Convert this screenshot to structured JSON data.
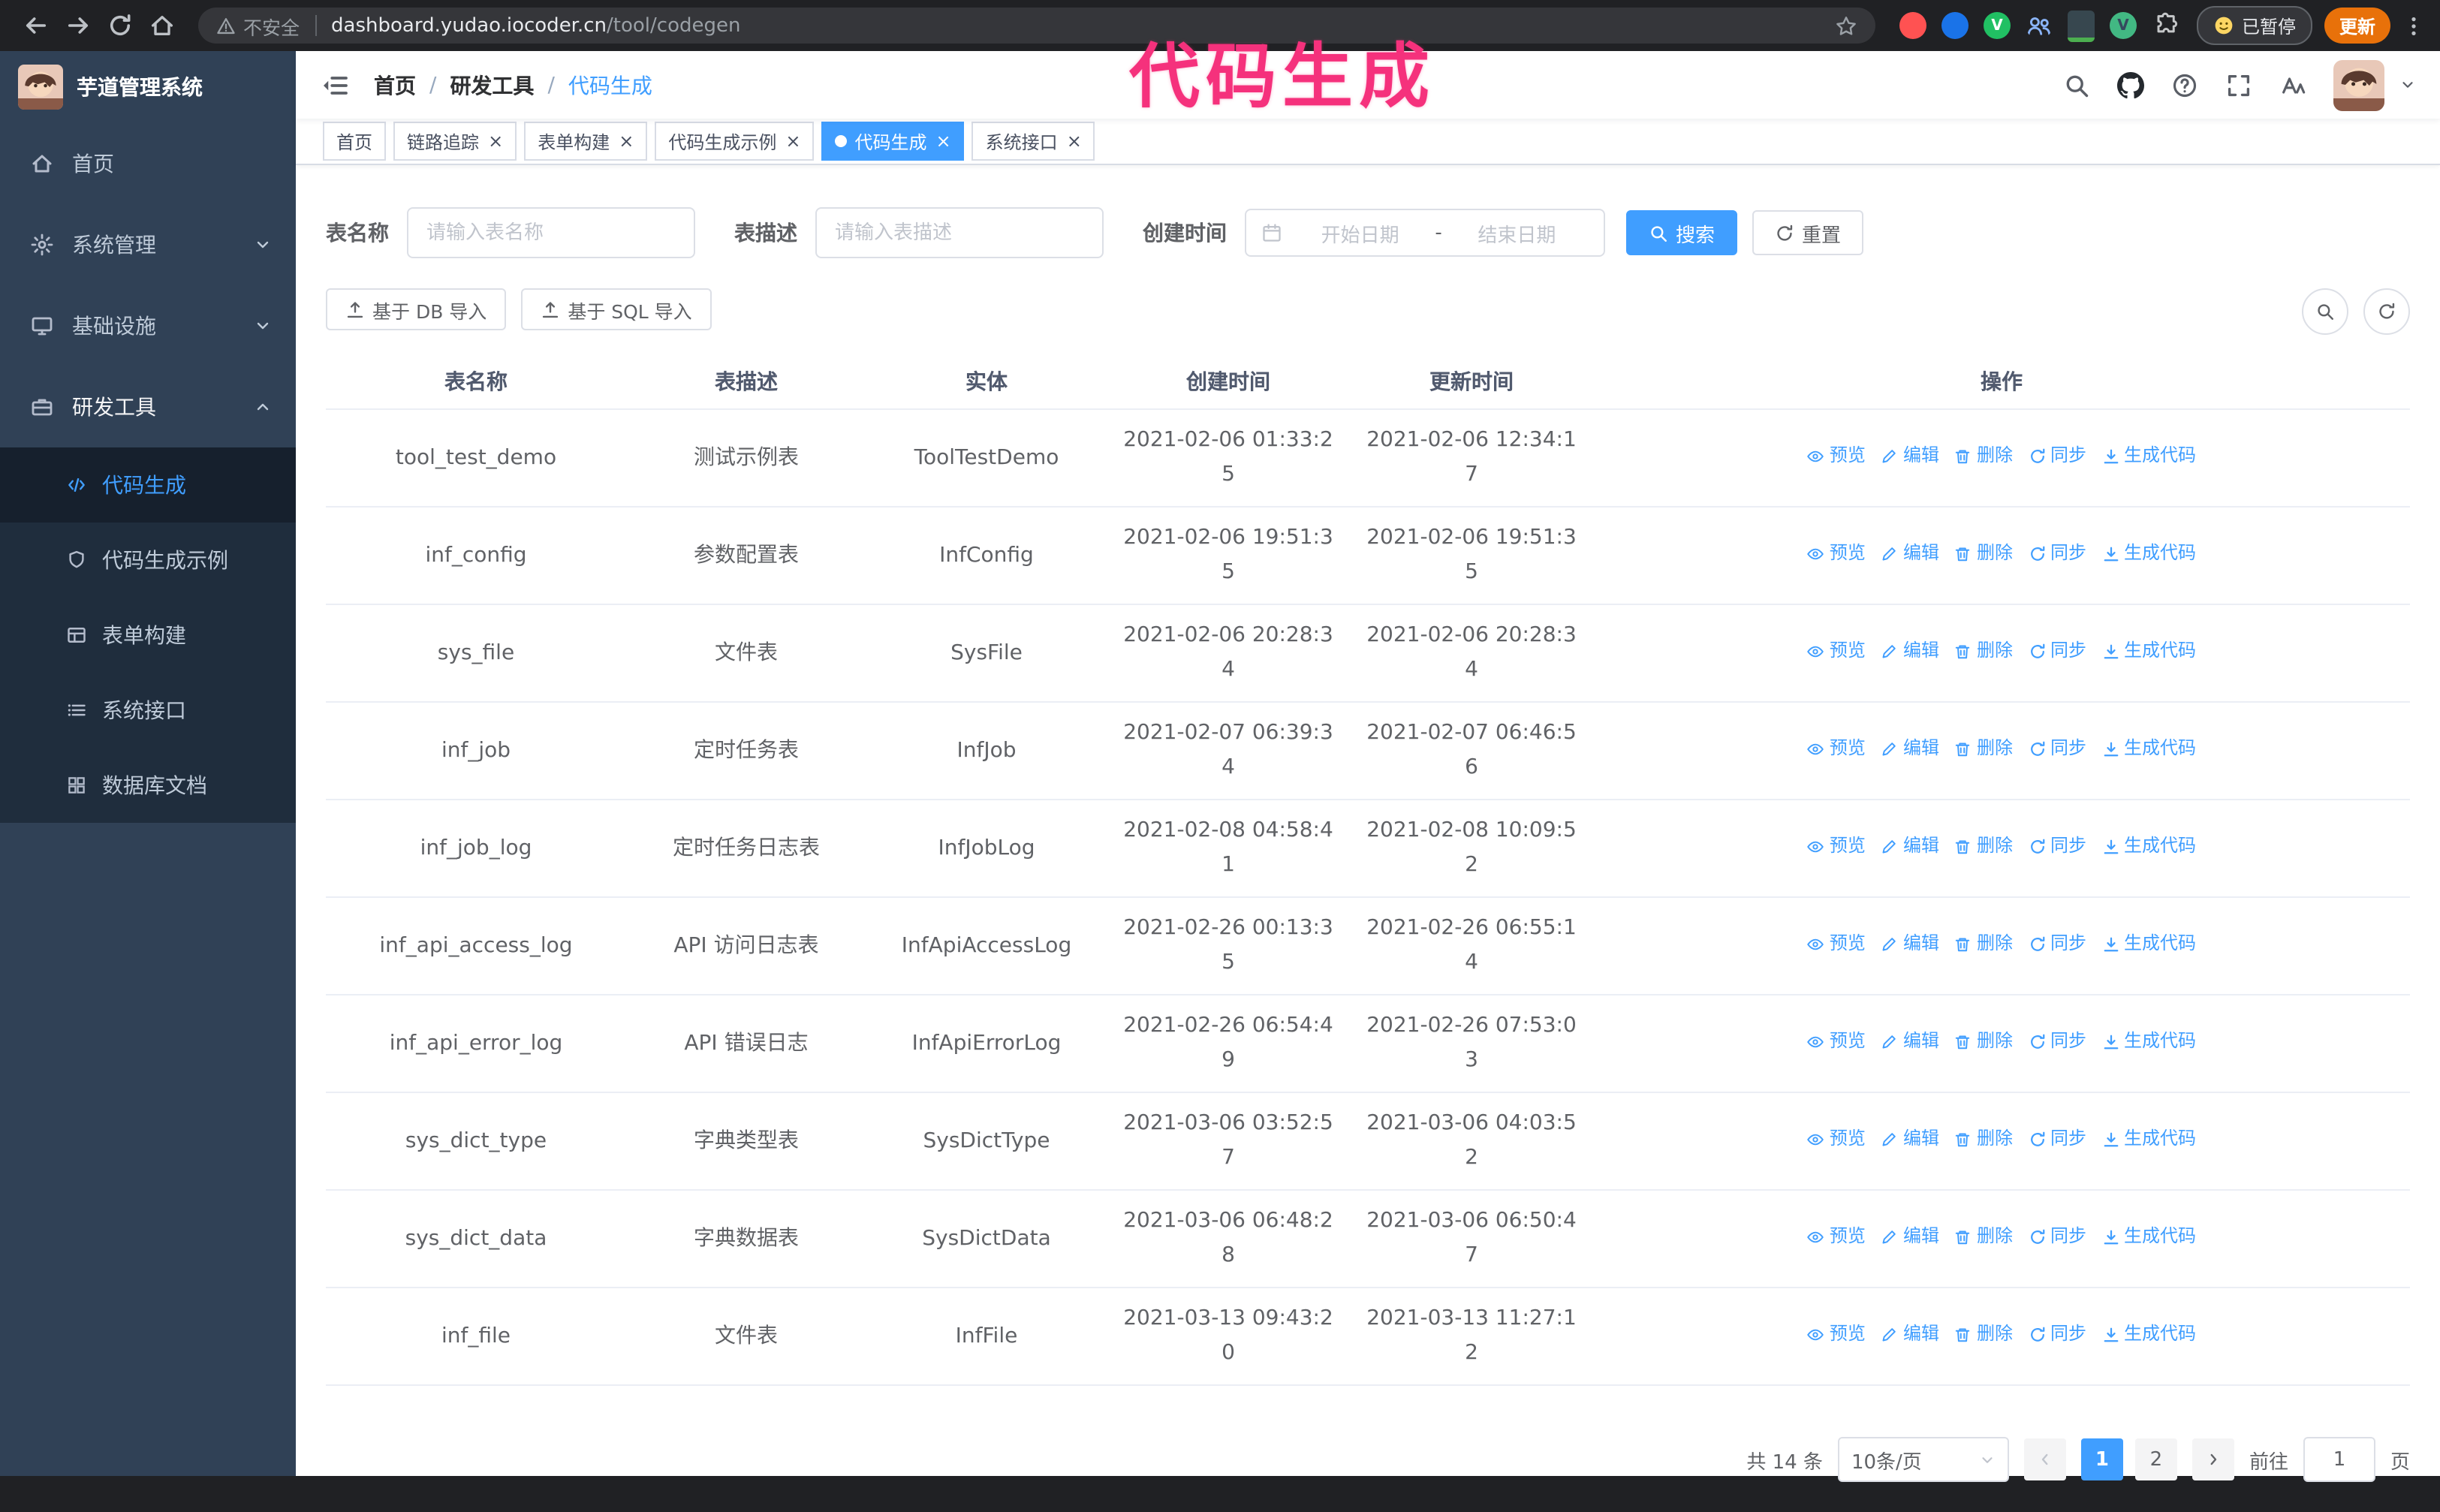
{
  "browser": {
    "security_warning": "不安全",
    "url_domain": "dashboard.yudao.iocoder.cn",
    "url_path": "/tool/codegen",
    "paused_badge": "已暂停",
    "update_button": "更新"
  },
  "annotation": {
    "text": "代码生成"
  },
  "colors": {
    "accent": "#409eff",
    "sidebar_bg": "#304156",
    "submenu_bg": "#1f2d3d",
    "annotation": "#f5317c",
    "chrome_bg": "#202124",
    "update_button_bg": "#e8710a"
  },
  "sidebar": {
    "logo_title": "芋道管理系统",
    "items": [
      {
        "label": "首页",
        "state": "none"
      },
      {
        "label": "系统管理",
        "state": "collapsed"
      },
      {
        "label": "基础设施",
        "state": "collapsed"
      },
      {
        "label": "研发工具",
        "state": "expanded"
      }
    ],
    "submenu": [
      {
        "label": "代码生成",
        "active": true
      },
      {
        "label": "代码生成示例",
        "active": false
      },
      {
        "label": "表单构建",
        "active": false
      },
      {
        "label": "系统接口",
        "active": false
      },
      {
        "label": "数据库文档",
        "active": false
      }
    ]
  },
  "navbar": {
    "breadcrumb": [
      "首页",
      "研发工具",
      "代码生成"
    ],
    "breadcrumb_separator": "/"
  },
  "tabs": [
    {
      "label": "首页",
      "closable": false,
      "active": false
    },
    {
      "label": "链路追踪",
      "closable": true,
      "active": false
    },
    {
      "label": "表单构建",
      "closable": true,
      "active": false
    },
    {
      "label": "代码生成示例",
      "closable": true,
      "active": false
    },
    {
      "label": "代码生成",
      "closable": true,
      "active": true
    },
    {
      "label": "系统接口",
      "closable": true,
      "active": false
    }
  ],
  "search_form": {
    "table_name_label": "表名称",
    "table_name_placeholder": "请输入表名称",
    "table_desc_label": "表描述",
    "table_desc_placeholder": "请输入表描述",
    "create_time_label": "创建时间",
    "date_start_placeholder": "开始日期",
    "date_separator": "-",
    "date_end_placeholder": "结束日期",
    "search_button": "搜索",
    "reset_button": "重置"
  },
  "toolbar": {
    "import_db_button": "基于 DB 导入",
    "import_sql_button": "基于 SQL 导入"
  },
  "table": {
    "columns": [
      "表名称",
      "表描述",
      "实体",
      "创建时间",
      "更新时间",
      "操作"
    ],
    "actions": [
      "预览",
      "编辑",
      "删除",
      "同步",
      "生成代码"
    ],
    "rows": [
      {
        "name": "tool_test_demo",
        "desc": "测试示例表",
        "entity": "ToolTestDemo",
        "create_time": "2021-02-06 01:33:25",
        "update_time": "2021-02-06 12:34:17"
      },
      {
        "name": "inf_config",
        "desc": "参数配置表",
        "entity": "InfConfig",
        "create_time": "2021-02-06 19:51:35",
        "update_time": "2021-02-06 19:51:35"
      },
      {
        "name": "sys_file",
        "desc": "文件表",
        "entity": "SysFile",
        "create_time": "2021-02-06 20:28:34",
        "update_time": "2021-02-06 20:28:34"
      },
      {
        "name": "inf_job",
        "desc": "定时任务表",
        "entity": "InfJob",
        "create_time": "2021-02-07 06:39:34",
        "update_time": "2021-02-07 06:46:56"
      },
      {
        "name": "inf_job_log",
        "desc": "定时任务日志表",
        "entity": "InfJobLog",
        "create_time": "2021-02-08 04:58:41",
        "update_time": "2021-02-08 10:09:52"
      },
      {
        "name": "inf_api_access_log",
        "desc": "API 访问日志表",
        "entity": "InfApiAccessLog",
        "create_time": "2021-02-26 00:13:35",
        "update_time": "2021-02-26 06:55:14"
      },
      {
        "name": "inf_api_error_log",
        "desc": "API 错误日志",
        "entity": "InfApiErrorLog",
        "create_time": "2021-02-26 06:54:49",
        "update_time": "2021-02-26 07:53:03"
      },
      {
        "name": "sys_dict_type",
        "desc": "字典类型表",
        "entity": "SysDictType",
        "create_time": "2021-03-06 03:52:57",
        "update_time": "2021-03-06 04:03:52"
      },
      {
        "name": "sys_dict_data",
        "desc": "字典数据表",
        "entity": "SysDictData",
        "create_time": "2021-03-06 06:48:28",
        "update_time": "2021-03-06 06:50:47"
      },
      {
        "name": "inf_file",
        "desc": "文件表",
        "entity": "InfFile",
        "create_time": "2021-03-13 09:43:20",
        "update_time": "2021-03-13 11:27:12"
      }
    ]
  },
  "pagination": {
    "total": "共 14 条",
    "page_size": "10条/页",
    "pages": [
      "1",
      "2"
    ],
    "active_page": "1",
    "goto_label": "前往",
    "goto_value": "1",
    "goto_suffix": "页"
  }
}
